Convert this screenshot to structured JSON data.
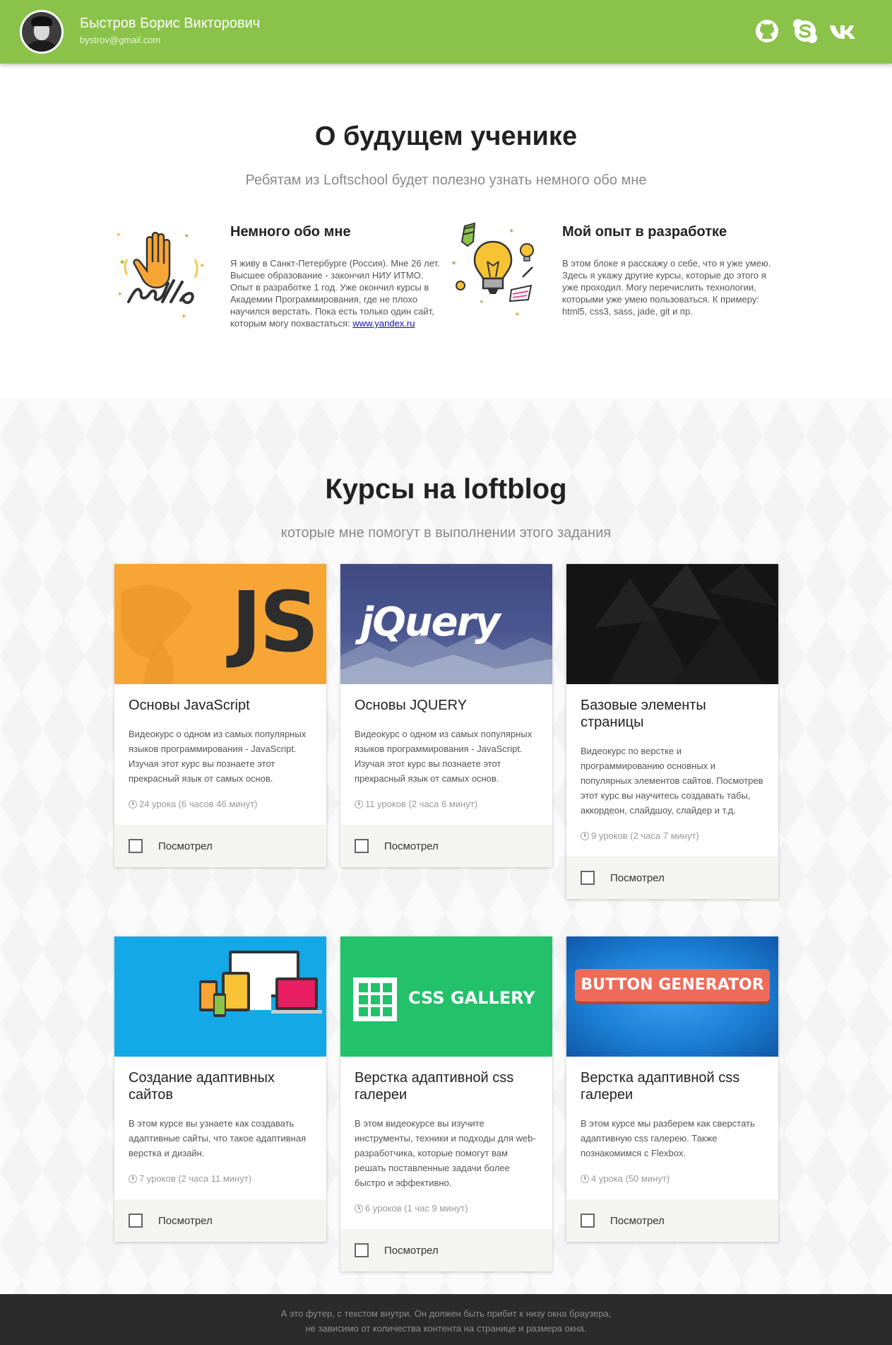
{
  "header": {
    "name": "Быстров Борис Викторович",
    "email": "bystrov@gmail.com",
    "social": [
      "github-icon",
      "skype-icon",
      "vk-icon"
    ]
  },
  "about": {
    "title": "О будущем ученике",
    "subtitle": "Ребятам из Loftschool будет полезно узнать немного обо мне",
    "blocks": [
      {
        "title": "Немного обо мне",
        "text": "Я живу в Санкт-Петербурге (Россия). Мне 26 лет. Высшее образование - закончил НИУ ИТМО. Опыт в разработке 1 год. Уже окончил курсы в Академии Программирования, где не плохо научился верстать. Пока есть только один сайт, которым могу похвастаться: ",
        "link": "www.yandex.ru"
      },
      {
        "title": "Мой опыт в разработке",
        "text": "В этом блоке я расскажу о себе, что я уже умею. Здесь я укажу другие курсы, которые до этого я уже проходил. Могу перечислить технологии, которыми уже умею пользоваться. К примеру: html5, css3, sass, jade, git и пр."
      }
    ]
  },
  "courses": {
    "title": "Курсы на loftblog",
    "subtitle": "которые мне помогут в выполнении этого задания",
    "watched_label": "Посмотрел",
    "items": [
      {
        "image_text": "JS",
        "title": "Основы JavaScript",
        "desc": "Видеокурс о одном из самых популярных языков программирования - JavaScript. Изучая этот курс вы познаете этот прекрасный язык от самых основ.",
        "meta": "24 урока (6 часов 46 минут)",
        "color": "#f7a534"
      },
      {
        "image_text": "jQuery",
        "title": "Основы JQUERY",
        "desc": "Видеокурс о одном из самых популярных языков программирования - JavaScript. Изучая этот курс вы познаете этот прекрасный язык от самых основ.",
        "meta": "11 уроков (2 часа 6 минут)",
        "color": "#3d4a7a"
      },
      {
        "image_text": "",
        "title": "Базовые элементы страницы",
        "desc": "Видеокурс по верстке и программированию основных и популярных элементов сайтов. Посмотрев этот курс вы научитесь создавать табы, аккордеон, слайдшоу, слайдер и т.д.",
        "meta": "9 уроков (2 часа 7 минут)",
        "color": "#141414"
      },
      {
        "image_text": "",
        "title": "Создание адаптивных сайтов",
        "desc": "В этом курсе вы узнаете как создавать адаптивные сайты, что такое адаптивная верстка и дизайн.",
        "meta": "7 уроков (2 часа 11 минут)",
        "color": "#14a8e6"
      },
      {
        "image_text": "CSS GALLERY",
        "title": "Верстка адаптивной css галереи",
        "desc": "В этом видеокурсе вы изучите инструменты, техники и подходы для web-разработчика, которые помогут вам решать поставленные задачи более быстро и эффективно.",
        "meta": "6 уроков (1 час 9 минут)",
        "color": "#22c16a"
      },
      {
        "image_text": "BUTTON GENERATOR",
        "title": "Верстка адаптивной css галереи",
        "desc": "В этом курсе мы разберем как сверстать адаптивную css галерею. Также познакомимся с Flexbox.",
        "meta": "4 урока (50 минут)",
        "color": "#1c80d6"
      }
    ]
  },
  "footer": {
    "line1": "А это футер, с текстом внутри. Он должен быть прибит к низу окна браузера,",
    "line2": "не зависимо от количества контента на странице и размера окна."
  }
}
